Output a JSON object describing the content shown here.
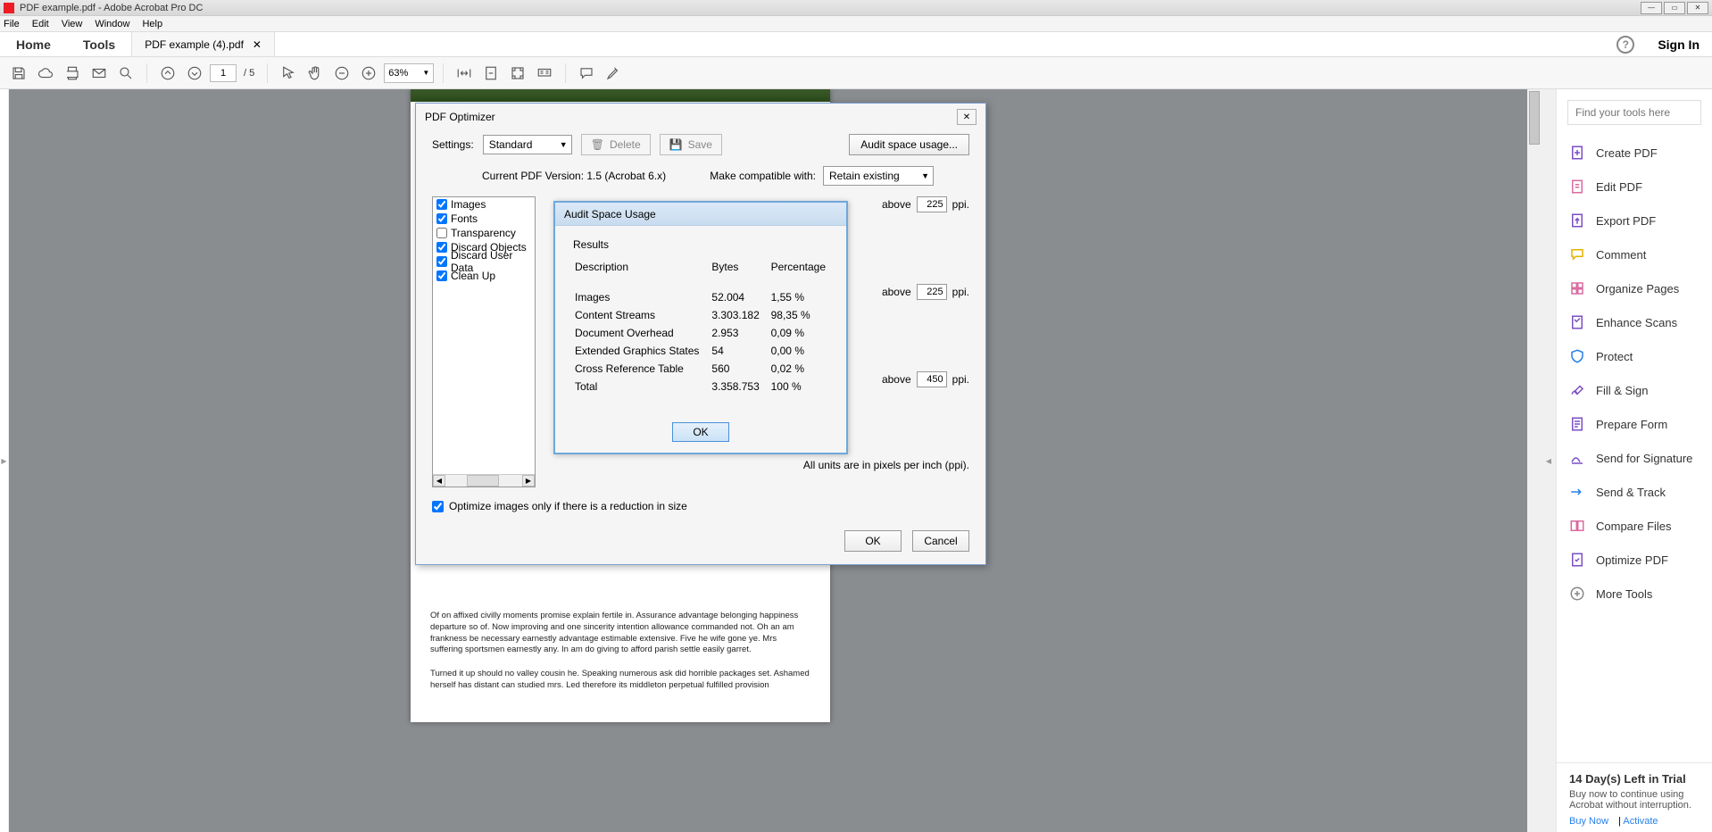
{
  "window": {
    "title": "PDF example.pdf - Adobe Acrobat Pro DC"
  },
  "menu": {
    "items": [
      "File",
      "Edit",
      "View",
      "Window",
      "Help"
    ]
  },
  "tabs": {
    "home": "Home",
    "tools": "Tools",
    "doc": "PDF example (4).pdf",
    "signin": "Sign In"
  },
  "toolbar": {
    "page_current": "1",
    "page_total": "/ 5",
    "zoom": "63%"
  },
  "document": {
    "p1": "Of on affixed civilly moments promise explain fertile in. Assurance advantage belonging happiness departure so of. Now improving and one sincerity intention allowance commanded not. Oh an am frankness be necessary earnestly advantage estimable extensive. Five he wife gone ye. Mrs suffering sportsmen earnestly any. In am do giving to afford parish settle easily garret.",
    "p2": "Turned it up should no valley cousin he. Speaking numerous ask did horrible packages set. Ashamed herself has distant can studied mrs. Led therefore its middleton perpetual fulfilled provision"
  },
  "right_panel": {
    "search_placeholder": "Find your tools here",
    "tools": [
      "Create PDF",
      "Edit PDF",
      "Export PDF",
      "Comment",
      "Organize Pages",
      "Enhance Scans",
      "Protect",
      "Fill & Sign",
      "Prepare Form",
      "Send for Signature",
      "Send & Track",
      "Compare Files",
      "Optimize PDF",
      "More Tools"
    ],
    "trial": {
      "title": "14 Day(s) Left in Trial",
      "desc": "Buy now to continue using Acrobat without interruption.",
      "buy": "Buy Now",
      "activate": "Activate"
    }
  },
  "optimizer": {
    "title": "PDF Optimizer",
    "settings_label": "Settings:",
    "settings_value": "Standard",
    "delete": "Delete",
    "save": "Save",
    "audit_btn": "Audit space usage...",
    "version": "Current PDF Version: 1.5 (Acrobat 6.x)",
    "compat_label": "Make compatible with:",
    "compat_value": "Retain existing",
    "categories": [
      {
        "label": "Images",
        "checked": true
      },
      {
        "label": "Fonts",
        "checked": true
      },
      {
        "label": "Transparency",
        "checked": false
      },
      {
        "label": "Discard Objects",
        "checked": true
      },
      {
        "label": "Discard User Data",
        "checked": true
      },
      {
        "label": "Clean Up",
        "checked": true
      }
    ],
    "ppi_above": "above",
    "ppi_unit": "ppi.",
    "ppi_vals": [
      "225",
      "225",
      "450"
    ],
    "units_note": "All units are in pixels per inch (ppi).",
    "opt_only": "Optimize images only if there is a reduction in size",
    "ok": "OK",
    "cancel": "Cancel"
  },
  "audit": {
    "title": "Audit Space Usage",
    "results": "Results",
    "headers": {
      "desc": "Description",
      "bytes": "Bytes",
      "pct": "Percentage"
    },
    "rows": [
      {
        "d": "Images",
        "b": "52.004",
        "p": "1,55 %"
      },
      {
        "d": "Content Streams",
        "b": "3.303.182",
        "p": "98,35 %"
      },
      {
        "d": "Document Overhead",
        "b": "2.953",
        "p": "0,09 %"
      },
      {
        "d": "Extended Graphics States",
        "b": "54",
        "p": "0,00 %"
      },
      {
        "d": "Cross Reference Table",
        "b": "560",
        "p": "0,02 %"
      },
      {
        "d": "Total",
        "b": "3.358.753",
        "p": "100 %"
      }
    ],
    "ok": "OK"
  }
}
